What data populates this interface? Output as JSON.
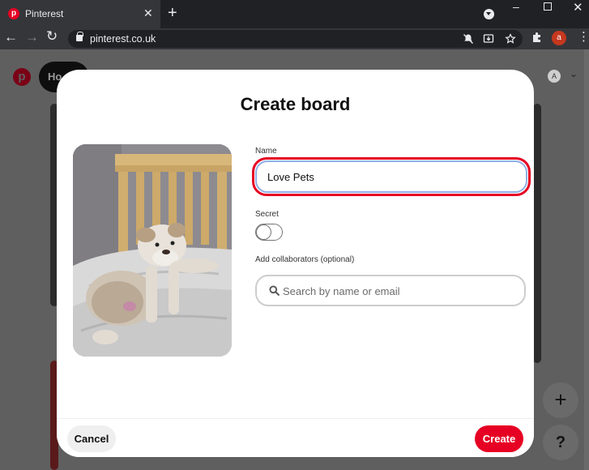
{
  "browser": {
    "tab_title": "Pinterest",
    "tab_favicon": "p",
    "tab_close": "✕",
    "new_tab": "+",
    "url": "pinterest.co.uk",
    "profile_initial": "a",
    "menu": "⋮",
    "window_min": "–",
    "window_close": "✕",
    "nav_back": "←",
    "nav_forward": "→",
    "nav_reload": "↻"
  },
  "background": {
    "logo": "p",
    "home_label": "Ho",
    "avatar_initial": "A",
    "plus_button": "+",
    "help_button": "?"
  },
  "modal": {
    "title": "Create board",
    "name_label": "Name",
    "name_value": "Love Pets",
    "secret_label": "Secret",
    "secret_enabled": false,
    "collaborators_label": "Add collaborators (optional)",
    "search_placeholder": "Search by name or email",
    "cancel_label": "Cancel",
    "create_label": "Create"
  },
  "colors": {
    "brand_red": "#e60023",
    "focus_blue": "#8fb0e6"
  }
}
